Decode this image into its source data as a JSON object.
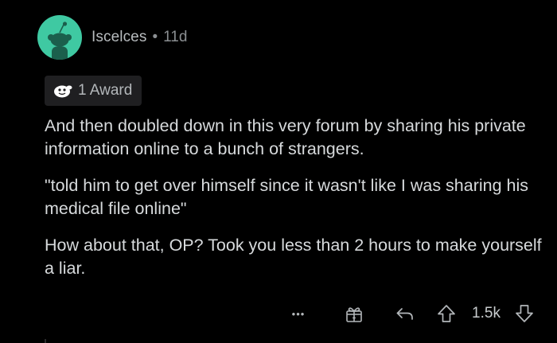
{
  "comment": {
    "username": "Iscelces",
    "separator": "•",
    "age": "11d",
    "award_label": "1 Award",
    "paragraphs": [
      "And then doubled down in this very forum by sharing his private information online to a bunch of strangers.",
      "\"told him to get over himself since it wasn't like I was sharing his medical file online\"",
      "How about that, OP? Took you less than 2 hours to make yourself a liar."
    ],
    "actions": {
      "more_label": "•••",
      "score": "1.5k"
    }
  },
  "colors": {
    "background": "#000000",
    "avatar_bg": "#3fc9a2",
    "text": "#d7dadc",
    "muted": "#8b8f92",
    "pill_bg": "#1f1f21"
  },
  "icons": {
    "avatar": "snoo-avatar-icon",
    "award": "award-icon",
    "more": "more-options-icon",
    "gift": "gift-award-icon",
    "reply": "reply-icon",
    "upvote": "upvote-arrow-icon",
    "downvote": "downvote-arrow-icon"
  }
}
